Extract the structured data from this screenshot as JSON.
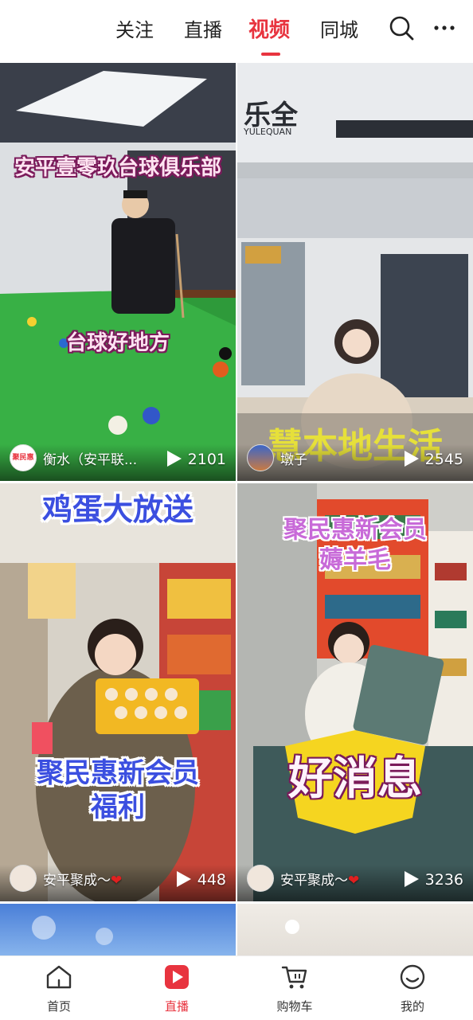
{
  "top_tabs": [
    {
      "label": "关注"
    },
    {
      "label": "直播"
    },
    {
      "label": "视频"
    },
    {
      "label": "同城"
    }
  ],
  "active_tab": "视频",
  "accent_color": "#e8343f",
  "icons": {
    "search": "search-icon",
    "more": "more-icon"
  },
  "cards": [
    {
      "captions": [
        "安平壹零玖台球俱乐部",
        "台球好地方"
      ],
      "avatar_text": "聚民惠",
      "author": "衡水（安平联...",
      "plays": "2101"
    },
    {
      "store_sign": "乐全",
      "store_sign_sub": "YULEQUAN",
      "banner_text": "慧本地生活",
      "author": "墩子",
      "plays": "2545"
    },
    {
      "captions": [
        "鸡蛋大放送",
        "聚民惠新会员",
        "福利"
      ],
      "author": "安平聚成～",
      "author_heart": "❤",
      "plays": "448"
    },
    {
      "captions": [
        "聚民惠新会员",
        "薅羊毛",
        "好消息"
      ],
      "author": "安平聚成～",
      "author_heart": "❤",
      "plays": "3236"
    }
  ],
  "bottom_nav": [
    {
      "label": "首页",
      "icon": "home-icon"
    },
    {
      "label": "直播",
      "icon": "live-icon"
    },
    {
      "label": "购物车",
      "icon": "cart-icon"
    },
    {
      "label": "我的",
      "icon": "profile-icon"
    }
  ],
  "bottom_nav_active": "直播"
}
